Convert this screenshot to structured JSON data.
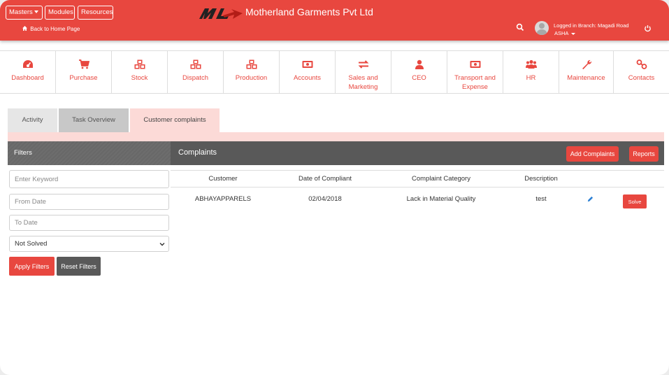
{
  "header": {
    "masters_label": "Masters",
    "modules_label": "Modules",
    "resources_label": "Resources",
    "back_label": "Back to Home Page",
    "company_name": "Motherland Garments Pvt Ltd",
    "branch_text": "Logged in Branch: Magadi Road",
    "user_name": "ASHA"
  },
  "modules": [
    {
      "label": "Dashboard",
      "icon": "dashboard-icon"
    },
    {
      "label": "Purchase",
      "icon": "cart-icon"
    },
    {
      "label": "Stock",
      "icon": "cubes-icon"
    },
    {
      "label": "Dispatch",
      "icon": "cubes-icon"
    },
    {
      "label": "Production",
      "icon": "cubes-icon"
    },
    {
      "label": "Accounts",
      "icon": "money-icon"
    },
    {
      "label": "Sales and Marketing",
      "icon": "exchange-icon"
    },
    {
      "label": "CEO",
      "icon": "user-icon"
    },
    {
      "label": "Transport and Expense",
      "icon": "money-icon"
    },
    {
      "label": "HR",
      "icon": "users-icon"
    },
    {
      "label": "Maintenance",
      "icon": "wrench-icon"
    },
    {
      "label": "Contacts",
      "icon": "link-icon"
    }
  ],
  "tabs": [
    {
      "label": "Activity"
    },
    {
      "label": "Task Overview"
    },
    {
      "label": "Customer complaints",
      "active": true
    }
  ],
  "filters": {
    "title": "Filters",
    "keyword_placeholder": "Enter Keyword",
    "from_date_placeholder": "From Date",
    "to_date_placeholder": "To Date",
    "status_selected": "Not Solved",
    "apply_label": "Apply Filters",
    "reset_label": "Reset Filters"
  },
  "complaints": {
    "title": "Complaints",
    "add_label": "Add Complaints",
    "reports_label": "Reports",
    "columns": [
      "Customer",
      "Date of Compliant",
      "Complaint Category",
      "Description"
    ],
    "rows": [
      {
        "customer": "ABHAYAPPARELS",
        "date": "02/04/2018",
        "category": "Lack in Material Quality",
        "description": "test",
        "action_label": "Solve"
      }
    ]
  },
  "colors": {
    "accent": "#e8473f",
    "dark_panel": "#595959",
    "tab_active_bg": "#fcdad7"
  }
}
